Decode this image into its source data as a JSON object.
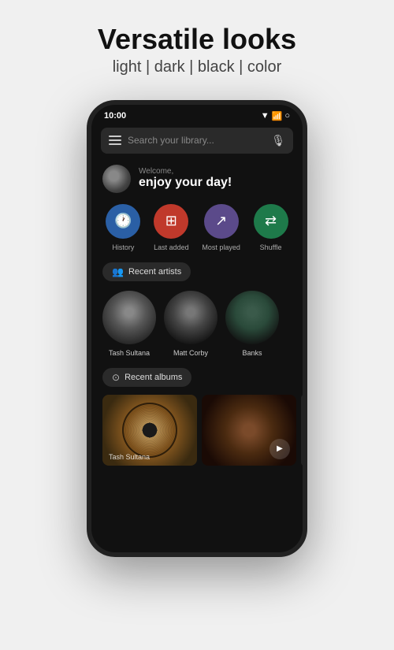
{
  "header": {
    "title": "Versatile looks",
    "subtitle": "light | dark | black | color"
  },
  "status_bar": {
    "time": "10:00"
  },
  "search": {
    "placeholder": "Search your library..."
  },
  "welcome": {
    "sub_label": "Welcome,",
    "main_label": "enjoy your day!"
  },
  "quick_actions": [
    {
      "id": "history",
      "label": "History",
      "icon": "🕐",
      "color_class": "icon-history"
    },
    {
      "id": "last-added",
      "label": "Last added",
      "icon": "⊞",
      "color_class": "icon-last-added"
    },
    {
      "id": "most-played",
      "label": "Most played",
      "icon": "↗",
      "color_class": "icon-most-played"
    },
    {
      "id": "shuffle",
      "label": "Shuffle",
      "icon": "⇄",
      "color_class": "icon-shuffle"
    }
  ],
  "sections": {
    "recent_artists_label": "Recent artists",
    "recent_albums_label": "Recent albums"
  },
  "artists": [
    {
      "name": "Tash Sultana"
    },
    {
      "name": "Matt Corby"
    },
    {
      "name": "Banks"
    }
  ],
  "albums": [
    {
      "label": "Tash Sultana"
    }
  ]
}
